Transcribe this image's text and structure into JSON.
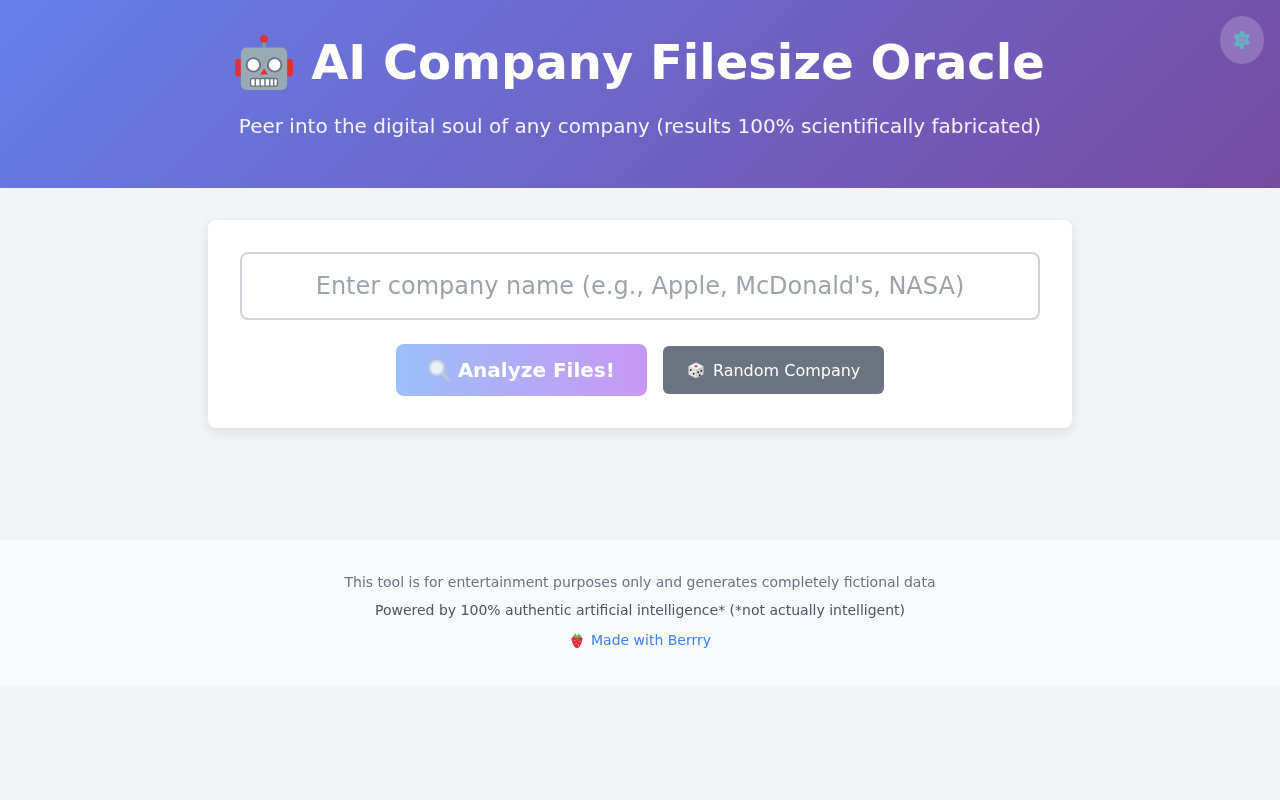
{
  "header": {
    "title": "AI Company Filesize Oracle",
    "subtitle": "Peer into the digital soul of any company (results 100% scientifically fabricated)"
  },
  "search": {
    "placeholder": "Enter company name (e.g., Apple, McDonald's, NASA)"
  },
  "buttons": [
    {
      "kind": "primary",
      "label": "Analyze Files!",
      "disabled": true
    },
    {
      "kind": "secondary",
      "label": "Random Company",
      "disabled": false
    }
  ],
  "footer": {
    "disclaimer": "This tool is for entertainment purposes only and generates completely fictional data",
    "credit": "Powered by 100% authentic artificial intelligence* (*not actually intelligent)",
    "link": "Made with Berrry"
  }
}
